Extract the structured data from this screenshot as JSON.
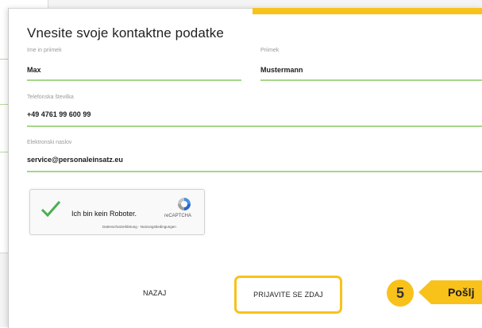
{
  "form": {
    "title": "Vnesite svoje kontaktne podatke",
    "first_name": {
      "label": "Ime in priimek",
      "value": "Max"
    },
    "last_name": {
      "label": "Priimek",
      "value": "Mustermann"
    },
    "phone": {
      "label": "Telefonska številka",
      "value": "+49 4761 99 600 99"
    },
    "email": {
      "label": "Elektronski naslov",
      "value": "service@personaleinsatz.eu"
    }
  },
  "recaptcha": {
    "label": "Ich bin kein Roboter.",
    "brand": "reCAPTCHA",
    "links": "Datenschutzerklärung - Nutzungsbedingungen",
    "icon": "recaptcha-logo-icon",
    "check_icon": "checkmark-icon"
  },
  "buttons": {
    "back_label": "NAZAJ",
    "submit_label": "PRIJAVITE SE ZDAJ"
  },
  "callout": {
    "step_number": "5",
    "text": "Pošlj"
  },
  "colors": {
    "accent": "#f8c21b",
    "underline": "#a6d58a",
    "check": "#4caf50"
  }
}
